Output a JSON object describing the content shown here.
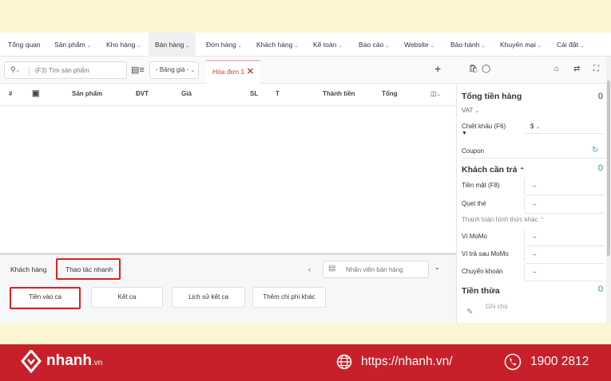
{
  "nav": {
    "items": [
      {
        "label": "Tổng quan",
        "chevron": false
      },
      {
        "label": "Sản phẩm",
        "chevron": true
      },
      {
        "label": "Kho hàng",
        "chevron": true
      },
      {
        "label": "Bán hàng",
        "chevron": true,
        "active": true
      },
      {
        "label": "Đơn hàng",
        "chevron": true
      },
      {
        "label": "Khách hàng",
        "chevron": true
      },
      {
        "label": "Kế toán",
        "chevron": true
      },
      {
        "label": "Báo cáo",
        "chevron": true
      },
      {
        "label": "Website",
        "chevron": true
      },
      {
        "label": "Bảo hành",
        "chevron": true
      },
      {
        "label": "Khuyến mại",
        "chevron": true
      },
      {
        "label": "Cài đặt",
        "chevron": true
      }
    ]
  },
  "toolbar": {
    "search_placeholder": "(F3) Tìm sản phẩm",
    "price_list": "- Bảng giá -",
    "invoice_tab": "Hóa đơn 1",
    "add_symbol": "+"
  },
  "table": {
    "headers": [
      "#",
      "Sản phẩm",
      "ĐVT",
      "Giá",
      "SL",
      "T",
      "Thành tiền",
      "Tổng"
    ]
  },
  "bottom": {
    "tabs": [
      "Khách hàng",
      "Thao tác nhanh"
    ],
    "active_tab": "Thao tác nhanh",
    "staff_placeholder": "Nhân viên bán hàng",
    "quick_actions": [
      "Tiền vào ca",
      "Kết ca",
      "Lịch sử kết ca",
      "Thêm chi phí khác"
    ],
    "highlighted_action": "Tiền vào ca"
  },
  "panel": {
    "total_label": "Tổng tiền hàng",
    "total_value": "0",
    "vat_label": "VAT",
    "discount_label": "Chiết khấu (F6)",
    "discount_unit": "$",
    "coupon_label": "Coupon",
    "customer_pay_label": "Khách cần trả",
    "customer_pay_value": "0",
    "cash_label": "Tiền mặt (F8)",
    "card_label": "Quẹt thẻ",
    "other_methods_label": "Thanh toán hình thức khác",
    "momo_label": "Ví MoMo",
    "momo_later_label": "Ví trả sau MoMo",
    "transfer_label": "Chuyển khoản",
    "change_label": "Tiền thừa",
    "change_value": "0",
    "note_placeholder": "Ghi chú"
  },
  "footer": {
    "brand": "nhanh",
    "brand_suffix": ".vn",
    "url": "https://nhanh.vn/",
    "phone": "1900 2812"
  },
  "colors": {
    "banner_bg": "#fdf6d3",
    "footer_bg": "#c7202a",
    "highlight_red": "#e02020",
    "green_value": "#2e9e3e"
  }
}
